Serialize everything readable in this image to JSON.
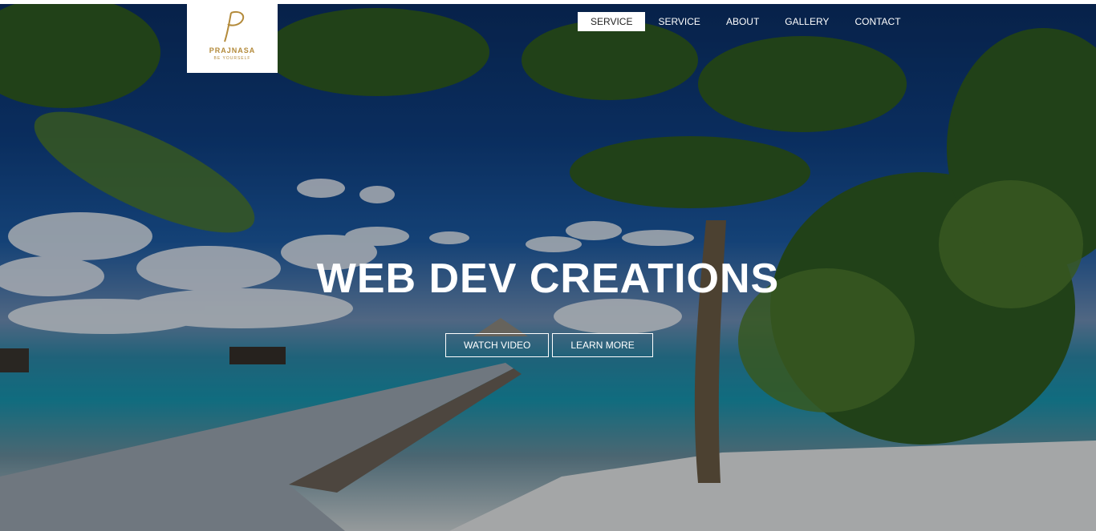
{
  "brand": {
    "name": "PRAJNASA",
    "tagline": "BE YOURSELF",
    "accent": "#b38a3a"
  },
  "nav": {
    "items": [
      "SERVICE",
      "SERVICE",
      "ABOUT",
      "GALLERY",
      "CONTACT"
    ]
  },
  "hero": {
    "title": "WEB DEV CREATIONS",
    "watch_label": "WATCH VIDEO",
    "learn_label": "LEARN MORE"
  }
}
